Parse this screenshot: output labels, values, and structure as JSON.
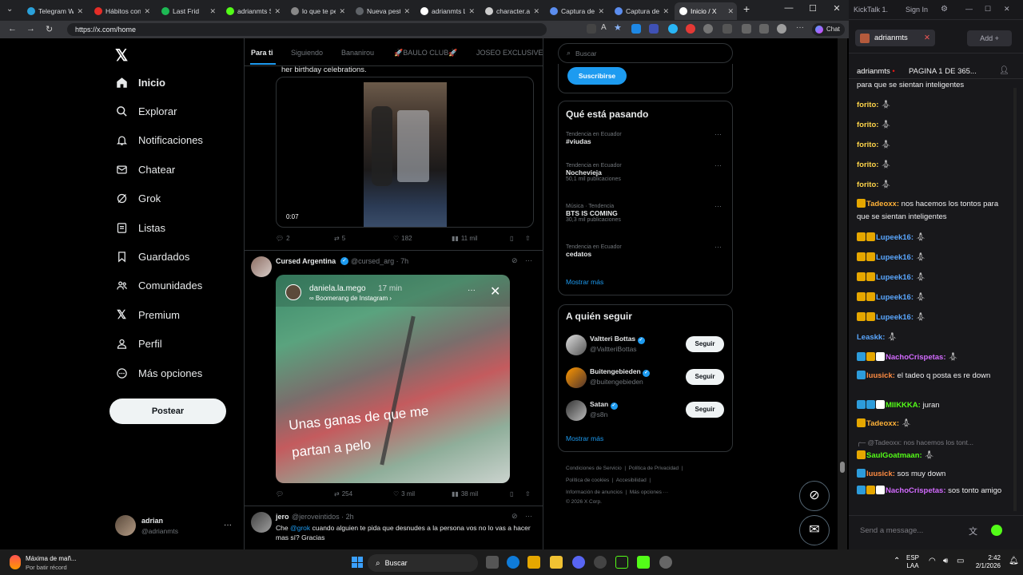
{
  "browser": {
    "tabs": [
      {
        "title": "Telegram Web",
        "color": "#2aa1da"
      },
      {
        "title": "Hábitos con Vi",
        "color": "#e52d27"
      },
      {
        "title": "Last Frid",
        "color": "#1db954"
      },
      {
        "title": "adrianmts St",
        "color": "#53fc18"
      },
      {
        "title": "lo que te pe",
        "color": "#888888"
      },
      {
        "title": "Nueva pestañ",
        "color": "#5f6368"
      },
      {
        "title": "adrianmts Le",
        "color": "#ffffff"
      },
      {
        "title": "character.ai |",
        "color": "#cccccc"
      },
      {
        "title": "Captura de p",
        "color": "#5b8def"
      },
      {
        "title": "Captura de p",
        "color": "#5b8def"
      },
      {
        "title": "Inicio / X",
        "color": "#ffffff"
      }
    ],
    "url": "https://x.com/home",
    "chat_label": "Chat"
  },
  "x": {
    "nav": [
      {
        "label": "Inicio",
        "icon": "home-icon"
      },
      {
        "label": "Explorar",
        "icon": "search-icon"
      },
      {
        "label": "Notificaciones",
        "icon": "bell-icon"
      },
      {
        "label": "Chatear",
        "icon": "mail-icon"
      },
      {
        "label": "Grok",
        "icon": "grok-icon"
      },
      {
        "label": "Listas",
        "icon": "list-icon"
      },
      {
        "label": "Guardados",
        "icon": "bookmark-icon"
      },
      {
        "label": "Comunidades",
        "icon": "people-icon"
      },
      {
        "label": "Premium",
        "icon": "x-logo-icon"
      },
      {
        "label": "Perfil",
        "icon": "person-icon"
      },
      {
        "label": "Más opciones",
        "icon": "more-circle-icon"
      }
    ],
    "post_button": "Postear",
    "account": {
      "name": "adrian",
      "handle": "@adrianmts"
    },
    "feed_tabs": [
      "Para ti",
      "Siguiendo",
      "Bananirou",
      "🚀BAULO CLUB🚀",
      "JOSEO EXCLUSIVE"
    ],
    "tweet1": {
      "text": "her birthday celebrations.",
      "duration": "0:07",
      "replies": "2",
      "reposts": "5",
      "likes": "182",
      "views": "11 mil"
    },
    "tweet2": {
      "name": "Cursed Argentina",
      "handle": "@cursed_arg · 7h",
      "story_user": "daniela.la.mego",
      "story_time": "17 min",
      "story_sub": "∞ Boomerang de Instagram ›",
      "caption1": "Unas ganas de que me",
      "caption2": "partan a pelo",
      "replies": "",
      "reposts": "254",
      "likes": "3 mil",
      "views": "38 mil"
    },
    "tweet3": {
      "name": "jero",
      "handle": "@jeroveintidos · 2h",
      "text_pre": "Che ",
      "mention": "@grok",
      "text_post": " cuando alguien te pida que desnudes a la persona vos no lo vas a hacer mas sí? Gracias"
    },
    "search_placeholder": "Buscar",
    "subscribe": "Suscribirse",
    "trends_title": "Qué está pasando",
    "trends": [
      {
        "meta": "Tendencia en Ecuador",
        "name": "#viudas",
        "count": ""
      },
      {
        "meta": "Tendencia en Ecuador",
        "name": "Nochevieja",
        "count": "50,1 mil publicaciones"
      },
      {
        "meta": "Música · Tendencia",
        "name": "BTS IS COMING",
        "count": "30,3 mil publicaciones"
      },
      {
        "meta": "Tendencia en Ecuador",
        "name": "cedatos",
        "count": ""
      }
    ],
    "show_more": "Mostrar más",
    "follow_title": "A quién seguir",
    "follow": [
      {
        "name": "Valtteri Bottas",
        "handle": "@ValtteriBottas",
        "button": "Seguir"
      },
      {
        "name": "Buitengebieden",
        "handle": "@buitengebieden",
        "button": "Seguir"
      },
      {
        "name": "Satan",
        "handle": "@s8n",
        "button": "Seguir"
      }
    ],
    "footer": {
      "l1a": "Condiciones de Servicio",
      "l1b": "Política de Privacidad",
      "l2a": "Política de cookies",
      "l2b": "Accesibilidad",
      "l3a": "Información de anuncios",
      "l3b": "Más opciones ···",
      "copy": "© 2026 X Corp."
    }
  },
  "kick": {
    "title": "KickTalk 1.",
    "signin": "Sign In",
    "channel_tab": "adrianmts",
    "add_label": "Add",
    "header_user": "adrianmts",
    "header_title": "PAGINA 1 DE 365...",
    "partial_top": "para que se sientan inteligentes",
    "messages": [
      {
        "user": "forito:",
        "color": "#ffd54a",
        "text": "",
        "badges": []
      },
      {
        "user": "forito:",
        "color": "#ffd54a",
        "text": "",
        "badges": []
      },
      {
        "user": "forito:",
        "color": "#ffd54a",
        "text": "",
        "badges": []
      },
      {
        "user": "forito:",
        "color": "#ffd54a",
        "text": "",
        "badges": []
      },
      {
        "user": "forito:",
        "color": "#ffd54a",
        "text": "",
        "badges": []
      },
      {
        "user": "Tadeoxx:",
        "color": "#ffb238",
        "text": "nos hacemos los tontos para que se sientan inteligentes",
        "badges": [
          "#e6a700"
        ]
      },
      {
        "user": "Lupeek16:",
        "color": "#5aa7ff",
        "text": "",
        "badges": [
          "#e6a700",
          "#e6a700"
        ]
      },
      {
        "user": "Lupeek16:",
        "color": "#5aa7ff",
        "text": "",
        "badges": [
          "#e6a700",
          "#e6a700"
        ]
      },
      {
        "user": "Lupeek16:",
        "color": "#5aa7ff",
        "text": "",
        "badges": [
          "#e6a700",
          "#e6a700"
        ]
      },
      {
        "user": "Lupeek16:",
        "color": "#5aa7ff",
        "text": "",
        "badges": [
          "#e6a700",
          "#e6a700"
        ]
      },
      {
        "user": "Lupeek16:",
        "color": "#5aa7ff",
        "text": "",
        "badges": [
          "#e6a700",
          "#e6a700"
        ]
      },
      {
        "user": "Leaskk:",
        "color": "#5aa7ff",
        "text": "",
        "badges": []
      },
      {
        "user": "NachoCrispetas:",
        "color": "#d36bff",
        "text": "",
        "badges": [
          "#2d9cdb",
          "#e6a700",
          "#ffffff"
        ]
      },
      {
        "user": "luusick:",
        "color": "#ff8c42",
        "text": "el tadeo q posta es re down",
        "badges": [
          "#2d9cdb"
        ]
      },
      {
        "user": "MIIKKKA:",
        "color": "#53fc18",
        "text": "juran",
        "badges": [
          "#2d9cdb",
          "#2d9cdb",
          "#ffffff"
        ]
      },
      {
        "user": "Tadeoxx:",
        "color": "#ffb238",
        "text": "",
        "badges": [
          "#e6a700"
        ]
      },
      {
        "user": "SaulGoatmaan:",
        "color": "#53fc18",
        "text": "",
        "badges": [
          "#e6a700"
        ]
      },
      {
        "user": "luusick:",
        "color": "#ff8c42",
        "text": "sos muy down",
        "badges": [
          "#2d9cdb"
        ]
      },
      {
        "user": "NachoCrispetas:",
        "color": "#d36bff",
        "text": "sos tonto amigo",
        "badges": [
          "#2d9cdb",
          "#e6a700",
          "#ffffff"
        ]
      }
    ],
    "reply_ref": "@Tadeoxx: nos hacemos los tont...",
    "input_placeholder": "Send a message..."
  },
  "taskbar": {
    "weather_title": "Máxima de mañ...",
    "weather_sub": "Por batir récord",
    "search": "Buscar",
    "lang1": "ESP",
    "lang2": "LAA",
    "time": "2:42",
    "date": "2/1/2026"
  }
}
